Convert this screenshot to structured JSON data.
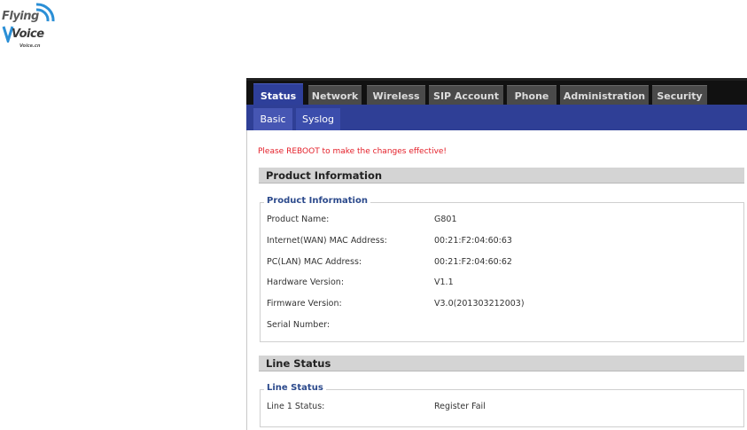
{
  "logo": {
    "line1": "Flying",
    "line2": "Voice",
    "tagline": "Voice.cn"
  },
  "tabs": [
    {
      "label": "Status",
      "active": true
    },
    {
      "label": "Network"
    },
    {
      "label": "Wireless"
    },
    {
      "label": "SIP Account"
    },
    {
      "label": "Phone"
    },
    {
      "label": "Administration"
    },
    {
      "label": "Security"
    }
  ],
  "subtabs": [
    {
      "label": "Basic",
      "active": true
    },
    {
      "label": "Syslog"
    }
  ],
  "warning": "Please REBOOT to make the changes effective!",
  "product_section": {
    "header": "Product Information",
    "legend": "Product Information",
    "rows": [
      {
        "label": "Product Name:",
        "value": "G801"
      },
      {
        "label": "Internet(WAN) MAC Address:",
        "value": "00:21:F2:04:60:63"
      },
      {
        "label": "PC(LAN) MAC Address:",
        "value": "00:21:F2:04:60:62"
      },
      {
        "label": "Hardware Version:",
        "value": "V1.1"
      },
      {
        "label": "Firmware Version:",
        "value": "V3.0(201303212003)"
      },
      {
        "label": "Serial Number:",
        "value": ""
      }
    ]
  },
  "line_section": {
    "header": "Line Status",
    "legend": "Line Status",
    "rows": [
      {
        "label": "Line 1 Status:",
        "value": "Register Fail"
      }
    ]
  },
  "colors": {
    "active_tab": "#2e3f9a",
    "warning": "#e4202a",
    "legend": "#2c4a8c"
  }
}
